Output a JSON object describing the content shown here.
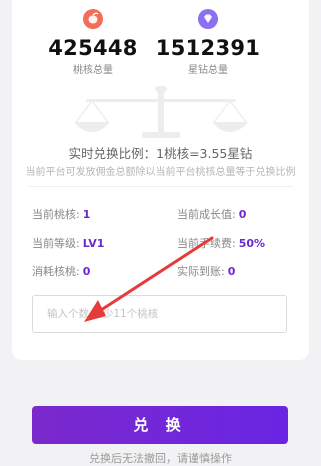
{
  "stats": [
    {
      "icon": "peach-icon",
      "value": "425448",
      "label": "桃核总量"
    },
    {
      "icon": "diamond-icon",
      "value": "1512391",
      "label": "星钻总量"
    }
  ],
  "ratio_text": "实时兑换比例：1桃核=3.55星钻",
  "note_text": "当前平台可发放佣金总额除以当前平台桃核总量等于兑换比例",
  "info": {
    "peach_label": "当前桃核:",
    "peach_value": "1",
    "growth_label": "当前成长值:",
    "growth_value": "0",
    "level_label": "当前等级:",
    "level_value": "LV1",
    "fee_label": "当前手续费:",
    "fee_value": "50%",
    "consume_label": "消耗核桃:",
    "consume_value": "0",
    "actual_label": "实际到账:",
    "actual_value": "0"
  },
  "exchange_input": {
    "value": "",
    "placeholder": "输入个数 至少11个桃核"
  },
  "exchange_button": "兑 换",
  "tip_text": "兑换后无法撤回，请谨慎操作",
  "colors": {
    "accent": "#6a2ad0",
    "peach": "#f06a55",
    "diamond": "#8a6cf0",
    "arrow": "#e63b3b"
  }
}
